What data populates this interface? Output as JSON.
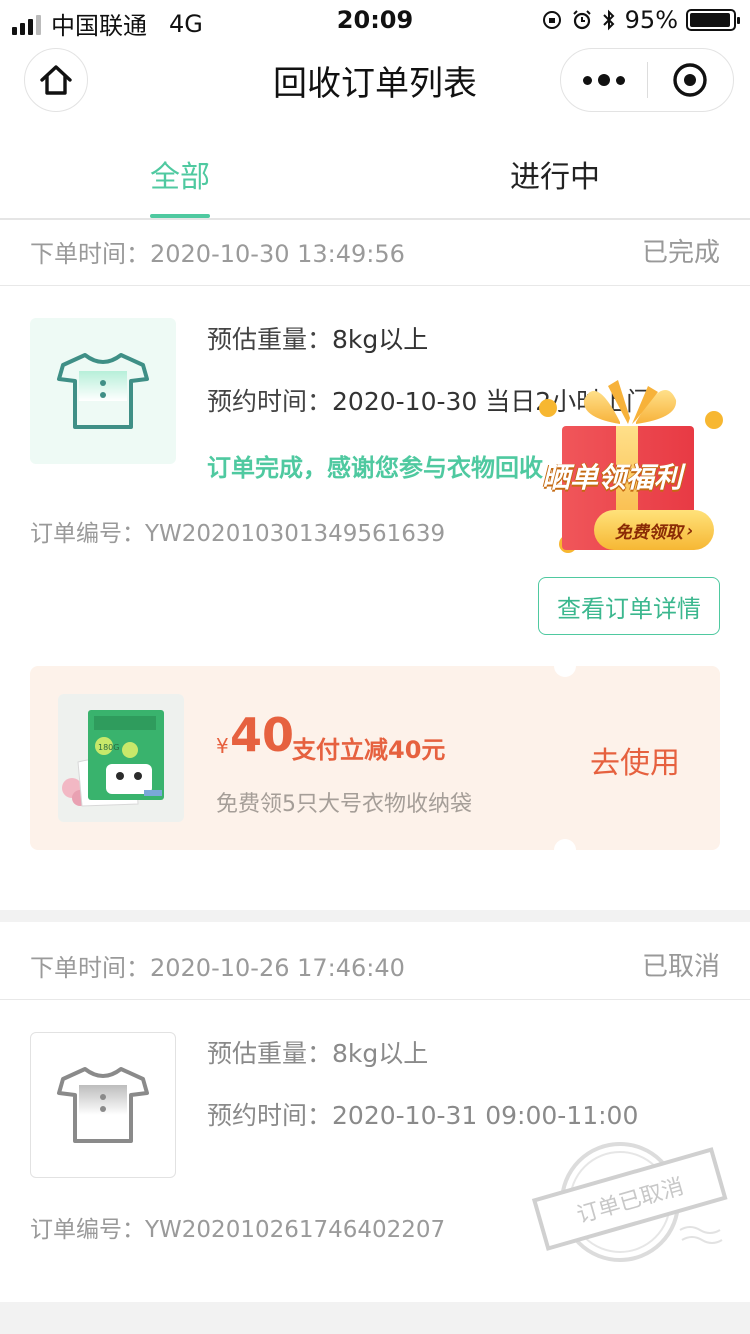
{
  "status_bar": {
    "carrier": "中国联通",
    "network": "4G",
    "time": "20:09",
    "battery": "95%"
  },
  "nav": {
    "title": "回收订单列表"
  },
  "tabs": [
    {
      "label": "全部",
      "active": true
    },
    {
      "label": "进行中",
      "active": false
    }
  ],
  "order1": {
    "time_label": "下单时间：",
    "time_value": "2020-10-30 13:49:56",
    "status": "已完成",
    "weight_label": "预估重量：",
    "weight_value": "8kg以上",
    "appoint_label": "预约时间：",
    "appoint_value": "2020-10-30 当日2小时上门",
    "message": "订单完成，感谢您参与衣物回收",
    "order_no_label": "订单编号：",
    "order_no": "YW202010301349561639",
    "detail_button": "查看订单详情"
  },
  "promo_badge": {
    "title": "晒单领福利",
    "button": "免费领取"
  },
  "coupon": {
    "currency": "¥",
    "amount": "40",
    "title": "支付立减40元",
    "subtitle": "免费领5只大号衣物收纳袋",
    "use_label": "去使用",
    "product_label": "180G"
  },
  "order2": {
    "time_label": "下单时间：",
    "time_value": "2020-10-26 17:46:40",
    "status": "已取消",
    "weight_label": "预估重量：",
    "weight_value": "8kg以上",
    "appoint_label": "预约时间：",
    "appoint_value": "2020-10-31 09:00-11:00",
    "order_no_label": "订单编号：",
    "order_no": "YW202010261746402207",
    "stamp": "订单已取消"
  },
  "colors": {
    "accent": "#4fc9a0",
    "coupon_red": "#e6613f",
    "coupon_bg": "#fdf2ea"
  }
}
